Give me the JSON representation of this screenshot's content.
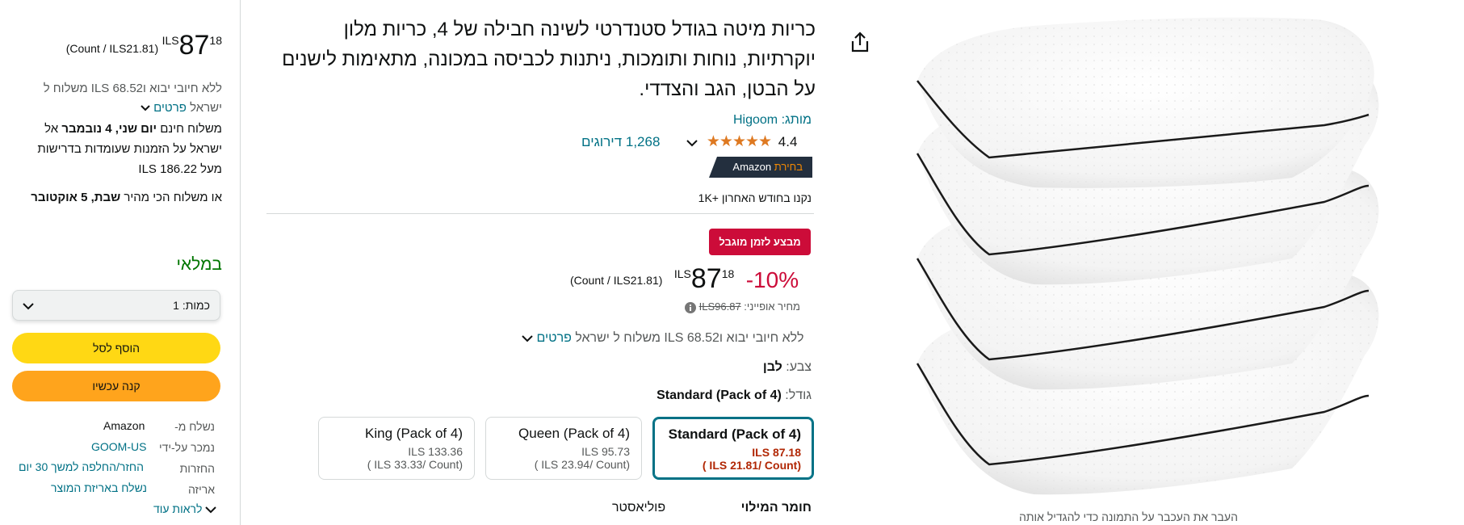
{
  "buybox": {
    "price_symbol": "ILS",
    "price_whole": "87",
    "price_fraction": "18",
    "unit_price": "(Count / ILS21.81)",
    "shipping_line1": "ללא חיובי יבוא ו‎ILS 68.52‎ משלוח ל",
    "shipping_line2_prefix": "ישראל",
    "details_link": "פרטים",
    "free_delivery_1_a": "משלוח חינם",
    "free_delivery_1_b": "יום שני, 4 נובמבר",
    "free_delivery_1_c": "אל",
    "free_delivery_2": "ישראל על הזמנות שעומדות בדרישות",
    "free_delivery_3": "מעל ILS 186.22",
    "fastest_a": "או משלוח הכי מהיר",
    "fastest_b": "שבת, 5 אוקטובר",
    "stock": "במלאי",
    "quantity_label": "כמות:",
    "quantity_value": "1",
    "add_to_cart": "הוסף לסל",
    "buy_now": "קנה עכשיו",
    "ships_from_label": "נשלח מ-",
    "ships_from_value": "Amazon",
    "sold_by_label": "נמכר על-ידי",
    "sold_by_value": "GOOM-US",
    "returns_label": "החזרות",
    "returns_value": "החזר/החלפה למשך 30 יום",
    "packaging_label": "אריזה",
    "packaging_value": "נשלח באריזת המוצר",
    "see_more": "לראות עוד"
  },
  "details": {
    "title": "כריות מיטה בגודל סטנדרטי לשינה חבילה של 4, כריות מלון יוקרתיות, נוחות ותומכות, ניתנות לכביסה במכונה, מתאימות לישנים על הבטן, הגב והצדדי.",
    "brand_label": "מותג:",
    "brand_value": "Higoom",
    "rating_value": "4.4",
    "stars": "★★★★★",
    "ratings_count": "1,268 דירוגים",
    "choice_badge_a": "Amazon",
    "choice_badge_b": "בחירת",
    "bought_past_month": "1K+ נקנו בחודש האחרון",
    "deal_badge": "מבצע לזמן מוגבל",
    "discount": "-10%",
    "price_symbol": "ILS",
    "price_whole": "87",
    "price_fraction": "18",
    "unit_price": "(Count / ILS21.81)",
    "typical_price_label": "מחיר אופייני:",
    "typical_price_value": "ILS96.87",
    "shipping_line": "ללא חיובי יבוא ו‎ILS 68.52‎ משלוח ל ישראל",
    "details_link": "פרטים",
    "color_label": "צבע:",
    "color_value": "לבן",
    "size_label": "גודל:",
    "size_value": "Standard (Pack of 4)",
    "sizes": [
      {
        "name": "Standard (Pack of 4)",
        "price": "ILS 87.18",
        "unit": "( ILS 21.81/ Count)"
      },
      {
        "name": "Queen (Pack of 4)",
        "price": "ILS 95.73",
        "unit": "( ILS 23.94/ Count)"
      },
      {
        "name": "King (Pack of 4)",
        "price": "ILS 133.36",
        "unit": "( ILS 33.33/ Count)"
      }
    ],
    "fill_material_label": "חומר המילוי",
    "fill_material_value": "פוליאסטר"
  },
  "image": {
    "zoom_hint": "העבר את העכבר על התמונה כדי להגדיל אותה"
  },
  "colors": {
    "link": "#007185",
    "deal_red": "#CC0C39",
    "discount_red": "#CC0C39",
    "add_to_cart_yellow": "#FFD814",
    "buy_now_orange": "#FFA41C",
    "in_stock_green": "#007600",
    "choice_navy": "#232F3E",
    "choice_orange": "#F08804"
  },
  "icons": {
    "share": "share-icon",
    "chevron": "chevron-down-icon",
    "info": "info-icon"
  }
}
